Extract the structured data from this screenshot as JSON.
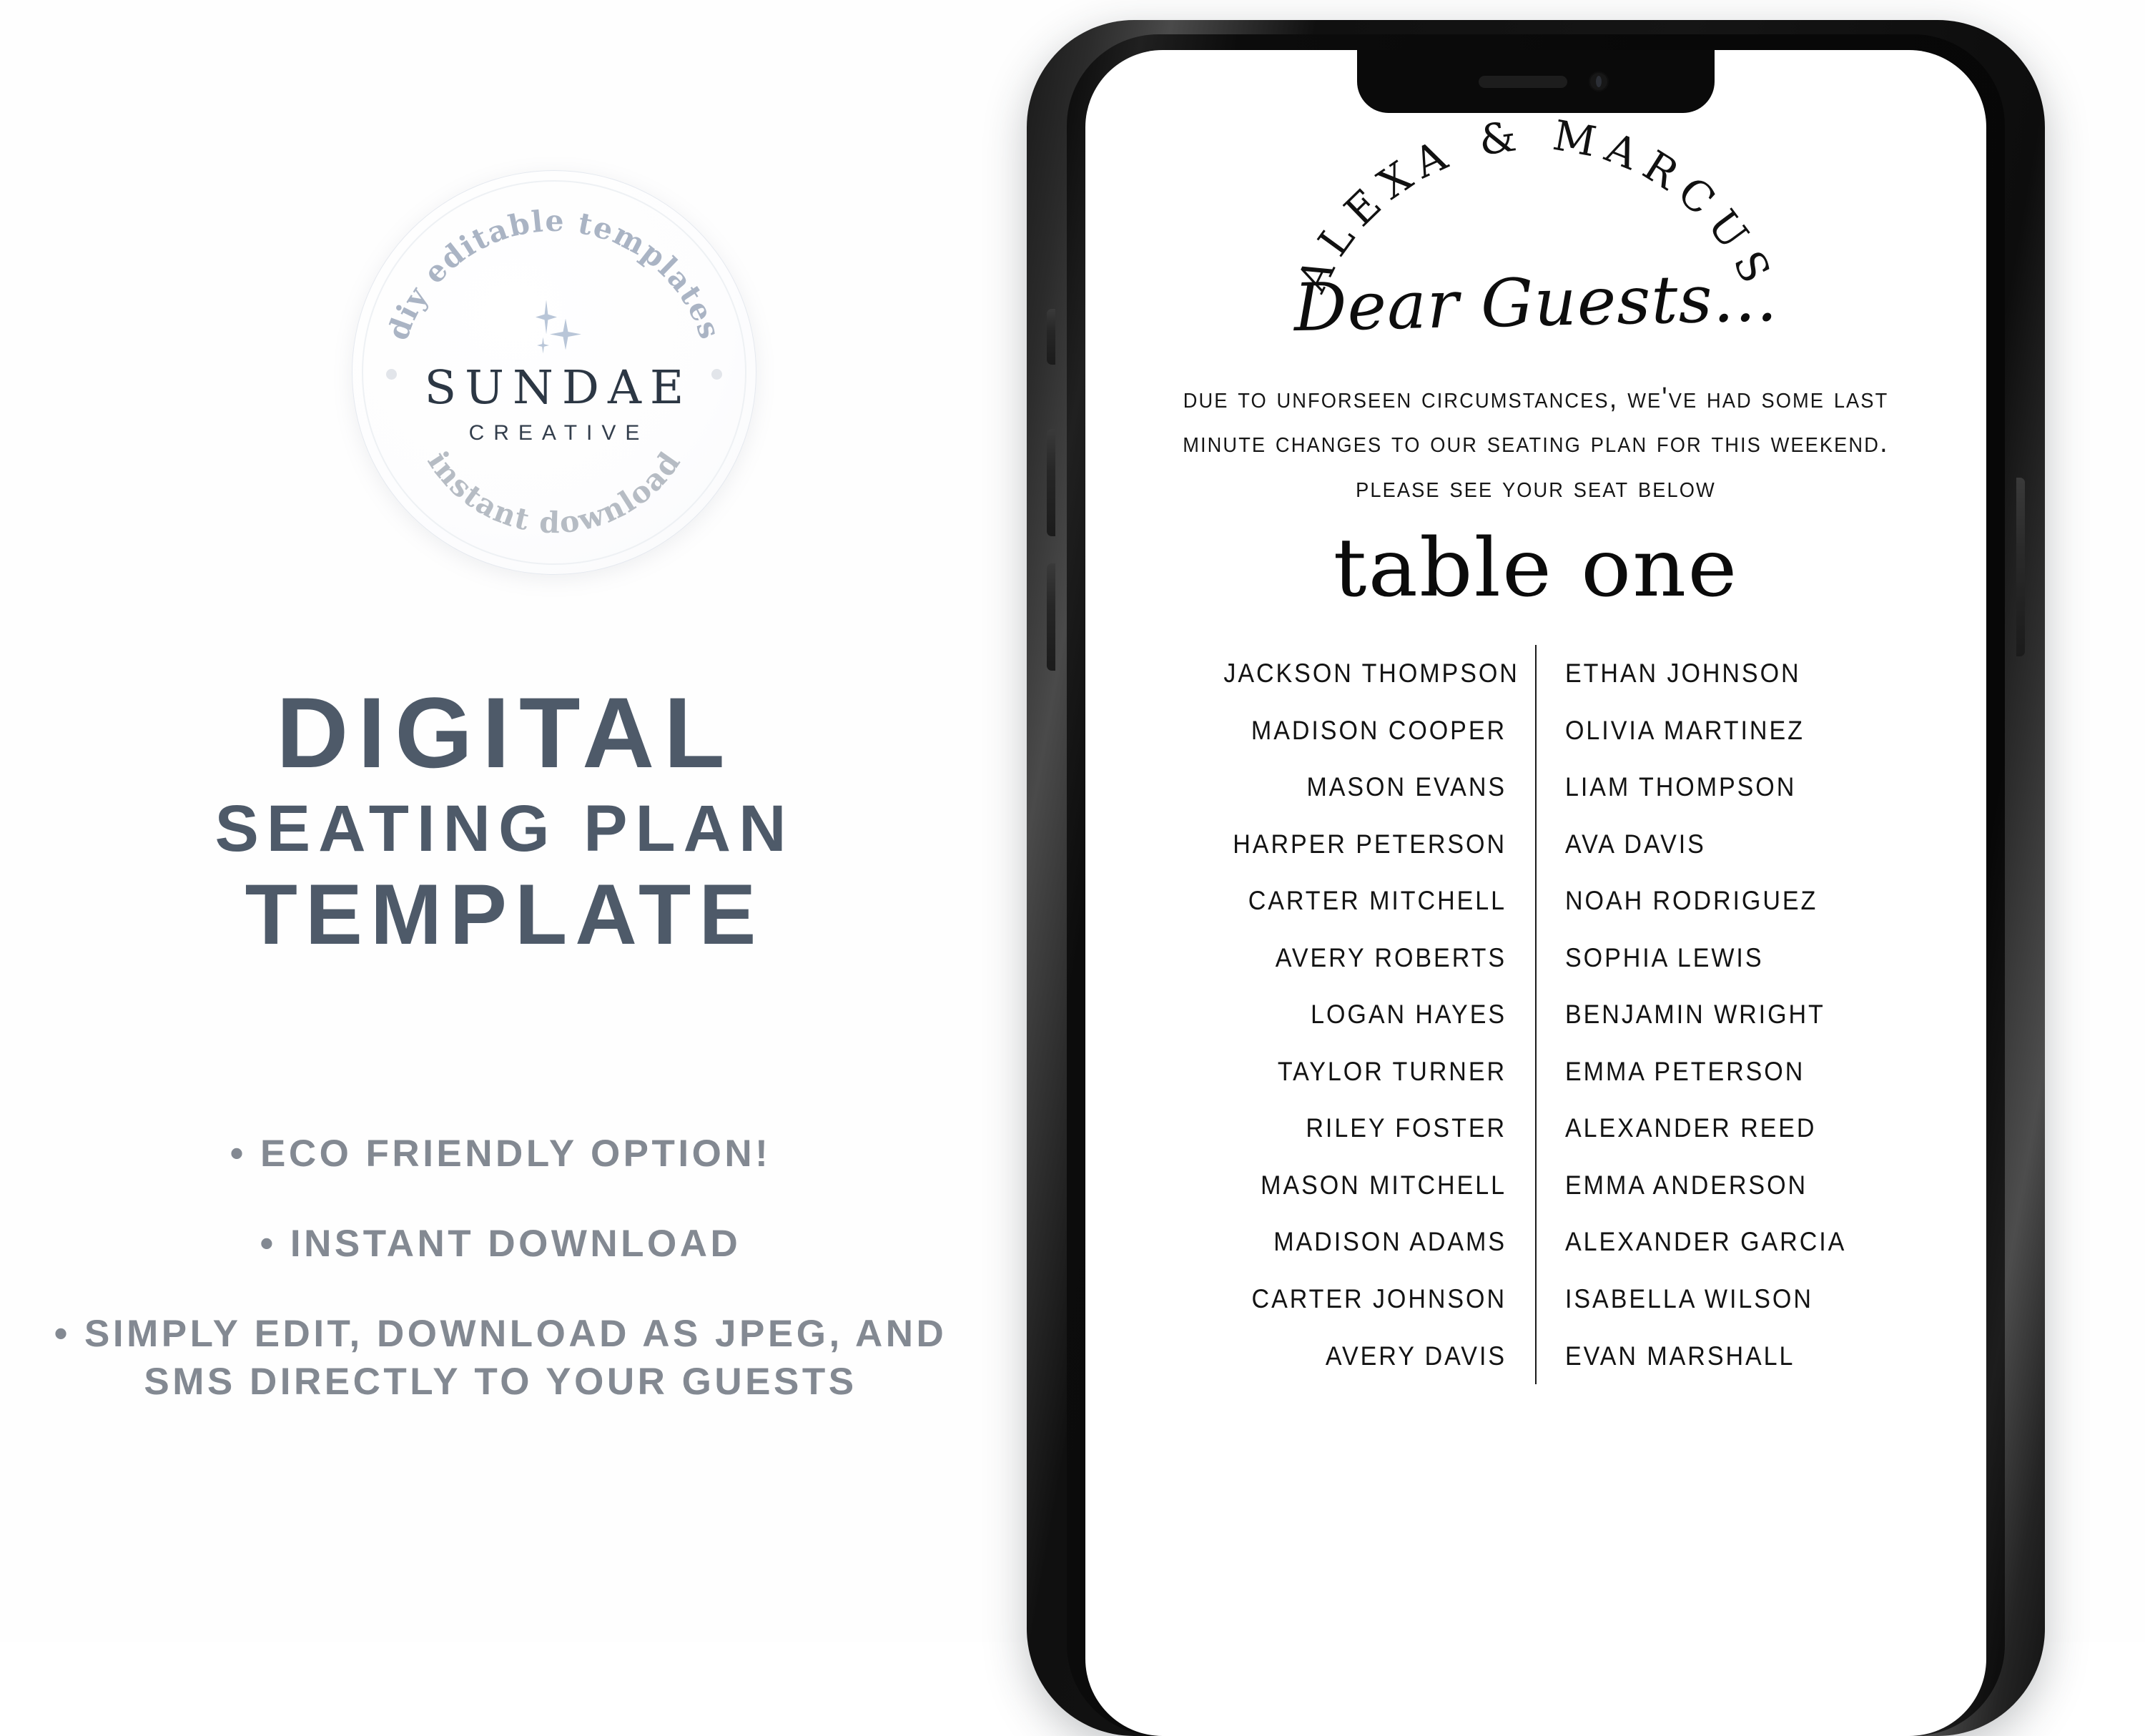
{
  "brand_badge": {
    "arc_top_text": "diy editable templates",
    "arc_bottom_text": "instant download",
    "wordmark": "SUNDAE",
    "sub_wordmark": "CREATIVE",
    "arc_top_color": "#aab4c4",
    "arc_bottom_color": "#b6bcc4",
    "wordmark_color": "#2c3744"
  },
  "headline": {
    "line1": "DIGITAL",
    "line2": "SEATING PLAN",
    "line3": "TEMPLATE",
    "color": "#4e5a69"
  },
  "features": {
    "color": "#838992",
    "items": [
      "• ECO FRIENDLY OPTION!",
      "• INSTANT DOWNLOAD",
      "• SIMPLY EDIT, DOWNLOAD AS JPEG, AND SMS DIRECTLY TO YOUR GUESTS"
    ]
  },
  "phone": {
    "device_color": "#101010",
    "screen_background": "#ffffff",
    "notch": {
      "speaker_icon": "speaker-grille-icon",
      "camera_icon": "front-camera-icon"
    },
    "buttons": {
      "mute": "mute-switch",
      "volume_up": "volume-up-button",
      "volume_down": "volume-down-button",
      "power": "power-button"
    }
  },
  "seating_card": {
    "couple_names": "ALEXA & MARCUS",
    "greeting": "Dear Guests...",
    "intro_paragraph": "Due to unforseen circumstances, we've had some last minute changes to our seating plan for this weekend. Please see your seat below",
    "table_title": "table one",
    "guests_left": [
      "JACKSON THOMPSON",
      "MADISON COOPER",
      "MASON EVANS",
      "HARPER PETERSON",
      "CARTER MITCHELL",
      "AVERY ROBERTS",
      "LOGAN HAYES",
      "TAYLOR TURNER",
      "RILEY FOSTER",
      "MASON MITCHELL",
      "MADISON ADAMS",
      "CARTER JOHNSON",
      "AVERY DAVIS"
    ],
    "guests_right": [
      "ETHAN JOHNSON",
      "OLIVIA MARTINEZ",
      "LIAM THOMPSON",
      "AVA DAVIS",
      "NOAH RODRIGUEZ",
      "SOPHIA LEWIS",
      "BENJAMIN WRIGHT",
      "EMMA PETERSON",
      "ALEXANDER REED",
      "EMMA ANDERSON",
      "ALEXANDER GARCIA",
      "ISABELLA WILSON",
      "EVAN MARSHALL"
    ]
  }
}
